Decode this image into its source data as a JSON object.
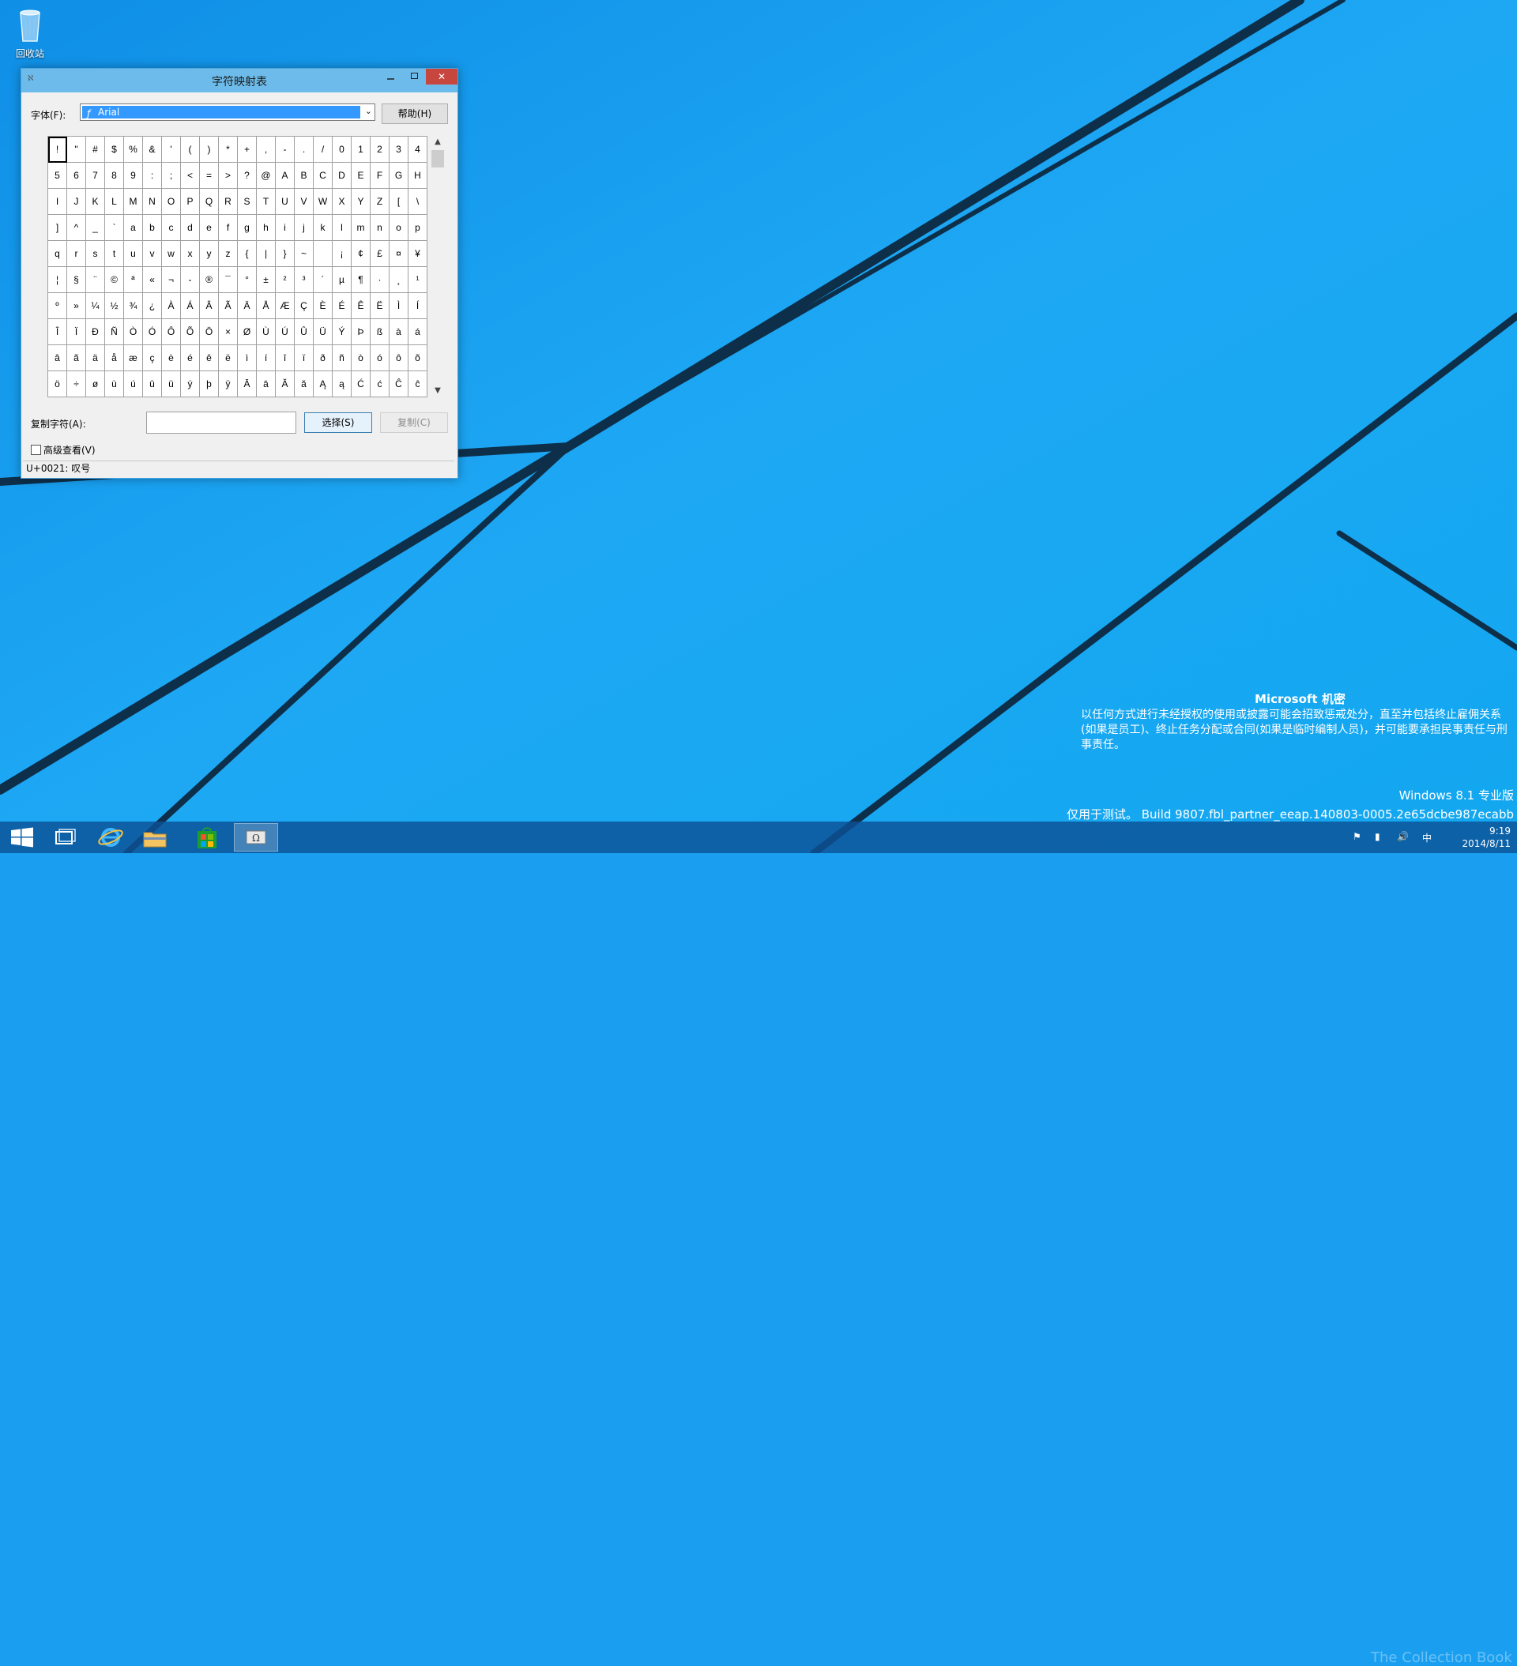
{
  "desktop": {
    "recycle_bin_label": "回收站"
  },
  "window": {
    "title": "字符映射表",
    "minimize_icon": "minimize-icon",
    "maximize_icon": "maximize-icon",
    "close_icon": "close-icon",
    "font_label": "字体(F):",
    "font_value": "Arial",
    "help_button": "帮助(H)",
    "copy_label": "复制字符(A):",
    "copy_value": "",
    "select_button": "选择(S)",
    "copy_button": "复制(C)",
    "advanced_label": "高级查看(V)",
    "status": "U+0021: 叹号",
    "grid": [
      [
        "!",
        "\"",
        "#",
        "$",
        "%",
        "&",
        "'",
        "(",
        ")",
        "*",
        "+",
        ",",
        "-",
        ".",
        "/",
        "0",
        "1",
        "2",
        "3",
        "4"
      ],
      [
        "5",
        "6",
        "7",
        "8",
        "9",
        ":",
        ";",
        "<",
        "=",
        ">",
        "?",
        "@",
        "A",
        "B",
        "C",
        "D",
        "E",
        "F",
        "G",
        "H"
      ],
      [
        "I",
        "J",
        "K",
        "L",
        "M",
        "N",
        "O",
        "P",
        "Q",
        "R",
        "S",
        "T",
        "U",
        "V",
        "W",
        "X",
        "Y",
        "Z",
        "[",
        "\\"
      ],
      [
        "]",
        "^",
        "_",
        "`",
        "a",
        "b",
        "c",
        "d",
        "e",
        "f",
        "g",
        "h",
        "i",
        "j",
        "k",
        "l",
        "m",
        "n",
        "o",
        "p"
      ],
      [
        "q",
        "r",
        "s",
        "t",
        "u",
        "v",
        "w",
        "x",
        "y",
        "z",
        "{",
        "|",
        "}",
        "~",
        " ",
        "¡",
        "¢",
        "£",
        "¤",
        "¥"
      ],
      [
        "¦",
        "§",
        "¨",
        "©",
        "ª",
        "«",
        "¬",
        "-",
        "®",
        "¯",
        "°",
        "±",
        "²",
        "³",
        "´",
        "µ",
        "¶",
        "·",
        "¸",
        "¹"
      ],
      [
        "º",
        "»",
        "¼",
        "½",
        "¾",
        "¿",
        "À",
        "Á",
        "Â",
        "Ã",
        "Ä",
        "Å",
        "Æ",
        "Ç",
        "È",
        "É",
        "Ê",
        "Ë",
        "Ì",
        "Í"
      ],
      [
        "Î",
        "Ï",
        "Ð",
        "Ñ",
        "Ò",
        "Ó",
        "Ô",
        "Õ",
        "Ö",
        "×",
        "Ø",
        "Ù",
        "Ú",
        "Û",
        "Ü",
        "Ý",
        "Þ",
        "ß",
        "à",
        "á"
      ],
      [
        "â",
        "ã",
        "ä",
        "å",
        "æ",
        "ç",
        "è",
        "é",
        "ê",
        "ë",
        "ì",
        "í",
        "î",
        "ï",
        "ð",
        "ñ",
        "ò",
        "ó",
        "ô",
        "õ"
      ],
      [
        "ö",
        "÷",
        "ø",
        "ù",
        "ú",
        "û",
        "ü",
        "ý",
        "þ",
        "ÿ",
        "Ā",
        "ā",
        "Ă",
        "ă",
        "Ą",
        "ą",
        "Ć",
        "ć",
        "Ĉ",
        "ĉ"
      ]
    ]
  },
  "watermark": {
    "title": "Microsoft 机密",
    "text": "以任何方式进行未经授权的使用或披露可能会招致惩戒处分，直至并包括终止雇佣关系(如果是员工)、终止任务分配或合同(如果是临时编制人员)，并可能要承担民事责任与刑事责任。",
    "version": "Windows 8.1 专业版",
    "build": "仅用于测试。 Build 9807.fbl_partner_eeap.140803-0005.2e65dcbe987ecabb"
  },
  "taskbar": {
    "items": [
      "start-icon",
      "task-view-icon",
      "internet-explorer-icon",
      "file-explorer-icon",
      "store-icon",
      "character-map-icon"
    ],
    "ime": "中",
    "time": "9:19",
    "date": "2014/8/11"
  },
  "colors": {
    "desktop": "#1a9ff0",
    "titlebar": "#6dbbea",
    "close": "#c7463e",
    "selection": "#3399ff"
  }
}
